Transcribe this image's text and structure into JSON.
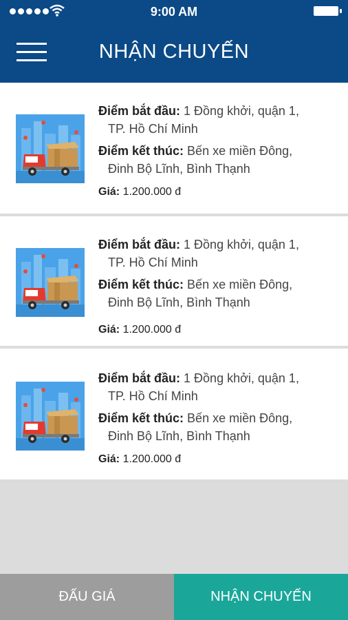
{
  "status_bar": {
    "time": "9:00 AM"
  },
  "header": {
    "title": "NHẬN CHUYẾN"
  },
  "orders": [
    {
      "start_label": "Điểm bắt đầu:",
      "start_line1": "1 Đồng khởi, quận 1,",
      "start_line2": "TP. Hồ Chí Minh",
      "end_label": "Điểm kết thúc:",
      "end_line1": "Bến xe miền Đông,",
      "end_line2": "Đinh Bộ Lĩnh, Bình Thạnh",
      "price_label": "Giá:",
      "price": "1.200.000 đ"
    },
    {
      "start_label": "Điểm bắt đầu:",
      "start_line1": "1 Đồng khởi, quận 1,",
      "start_line2": "TP. Hồ Chí Minh",
      "end_label": "Điểm kết thúc:",
      "end_line1": "Bến xe miền Đông,",
      "end_line2": "Đinh Bộ Lĩnh, Bình Thạnh",
      "price_label": "Giá:",
      "price": "1.200.000 đ"
    },
    {
      "start_label": "Điểm bắt đầu:",
      "start_line1": "1 Đồng khởi, quận 1,",
      "start_line2": "TP. Hồ Chí Minh",
      "end_label": "Điểm kết thúc:",
      "end_line1": "Bến xe miền Đông,",
      "end_line2": "Đinh Bộ Lĩnh, Bình Thạnh",
      "price_label": "Giá:",
      "price": "1.200.000 đ"
    }
  ],
  "bottom_nav": {
    "tab_bid": "ĐẤU GIÁ",
    "tab_receive": "NHẬN CHUYẾN"
  },
  "colors": {
    "header": "#0b4a86",
    "active_tab": "#1aa79a",
    "inactive_tab": "#9d9d9d"
  }
}
